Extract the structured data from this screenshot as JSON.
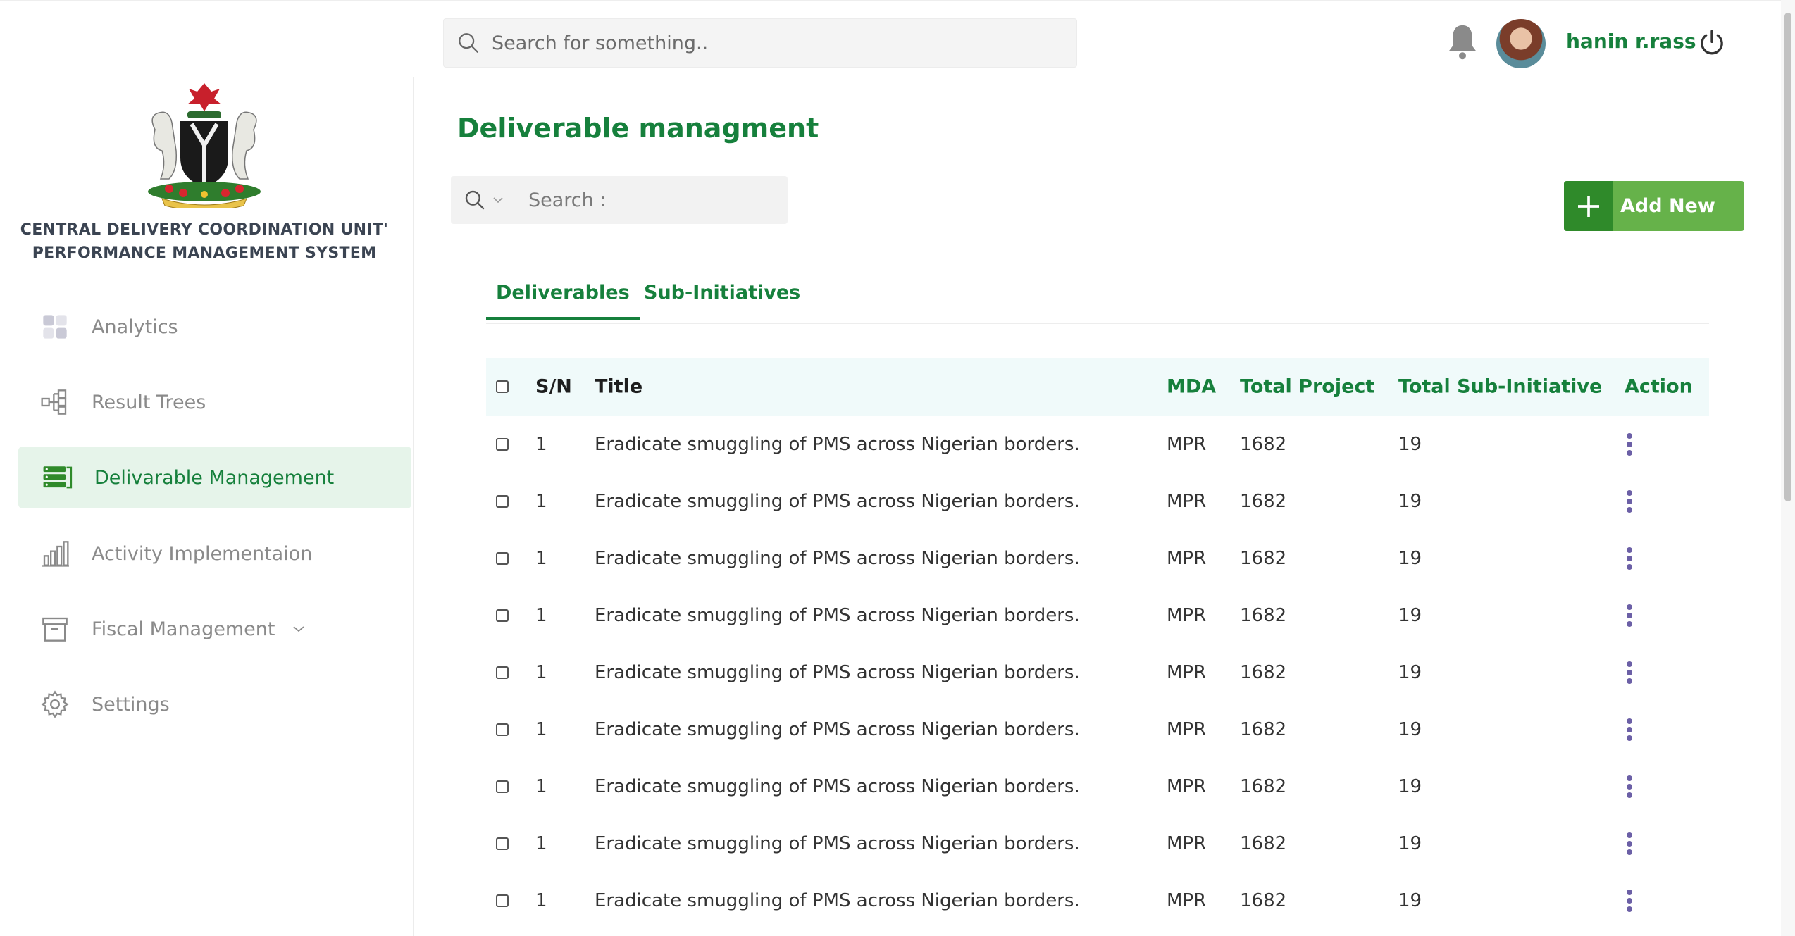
{
  "header": {
    "search_placeholder": "Search for something..",
    "username": "hanin r.rass"
  },
  "sidebar": {
    "org_line1": "CENTRAL DELIVERY COORDINATION UNIT'",
    "org_line2": "PERFORMANCE MANAGEMENT SYSTEM",
    "items": [
      {
        "label": "Analytics",
        "icon": "analytics-icon"
      },
      {
        "label": "Result Trees",
        "icon": "tree-icon"
      },
      {
        "label": "Delivarable Management",
        "icon": "deliverable-icon",
        "active": true
      },
      {
        "label": "Activity Implementaion",
        "icon": "bar-chart-icon"
      },
      {
        "label": "Fiscal Management",
        "icon": "archive-icon",
        "has_dropdown": true
      },
      {
        "label": "Settings",
        "icon": "gear-icon"
      }
    ]
  },
  "main": {
    "title": "Deliverable managment",
    "search_placeholder": "Search :",
    "add_button": "Add New",
    "tabs": [
      {
        "label": "Deliverables",
        "active": true
      },
      {
        "label": "Sub-Initiatives",
        "active": false
      }
    ],
    "table": {
      "columns": [
        "S/N",
        "Title",
        "MDA",
        "Total Project",
        "Total Sub-Initiative",
        "Action"
      ],
      "rows": [
        {
          "sn": "1",
          "title": "Eradicate smuggling of PMS across Nigerian borders.",
          "mda": "MPR",
          "total_project": "1682",
          "total_sub": "19"
        },
        {
          "sn": "1",
          "title": "Eradicate smuggling of PMS across Nigerian borders.",
          "mda": "MPR",
          "total_project": "1682",
          "total_sub": "19"
        },
        {
          "sn": "1",
          "title": "Eradicate smuggling of PMS across Nigerian borders.",
          "mda": "MPR",
          "total_project": "1682",
          "total_sub": "19"
        },
        {
          "sn": "1",
          "title": "Eradicate smuggling of PMS across Nigerian borders.",
          "mda": "MPR",
          "total_project": "1682",
          "total_sub": "19"
        },
        {
          "sn": "1",
          "title": "Eradicate smuggling of PMS across Nigerian borders.",
          "mda": "MPR",
          "total_project": "1682",
          "total_sub": "19"
        },
        {
          "sn": "1",
          "title": "Eradicate smuggling of PMS across Nigerian borders.",
          "mda": "MPR",
          "total_project": "1682",
          "total_sub": "19"
        },
        {
          "sn": "1",
          "title": "Eradicate smuggling of PMS across Nigerian borders.",
          "mda": "MPR",
          "total_project": "1682",
          "total_sub": "19"
        },
        {
          "sn": "1",
          "title": "Eradicate smuggling of PMS across Nigerian borders.",
          "mda": "MPR",
          "total_project": "1682",
          "total_sub": "19"
        },
        {
          "sn": "1",
          "title": "Eradicate smuggling of PMS across Nigerian borders.",
          "mda": "MPR",
          "total_project": "1682",
          "total_sub": "19"
        }
      ]
    }
  },
  "colors": {
    "brand_green": "#16803c",
    "button_green": "#66b24a",
    "button_dark_green": "#2f8a2a",
    "active_bg": "#e6f4ea",
    "table_header_bg": "#f0fafa",
    "kebab": "#6b5fa6"
  }
}
